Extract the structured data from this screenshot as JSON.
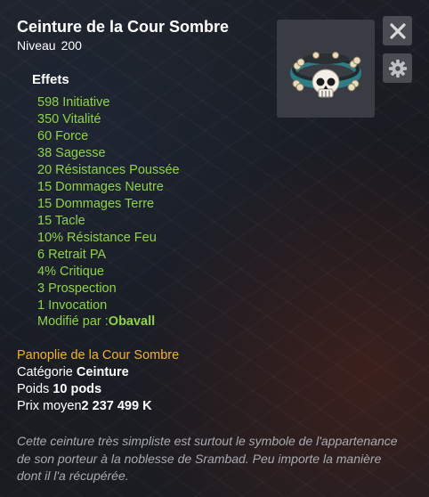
{
  "item": {
    "name": "Ceinture de la Cour Sombre",
    "level_label": "Niveau",
    "level_value": "200",
    "image_alt_icon": "skull-belt-icon"
  },
  "effects": {
    "title": "Effets",
    "lines": [
      "598 Initiative",
      "350 Vitalité",
      "60 Force",
      "38 Sagesse",
      "20 Résistances Poussée",
      "15 Dommages Neutre",
      "15 Dommages Terre",
      "15 Tacle",
      "10% Résistance Feu",
      "6 Retrait PA",
      "4% Critique",
      "3 Prospection",
      "1 Invocation"
    ],
    "modified_label": "Modifié par :",
    "modified_by": "Obavall"
  },
  "details": {
    "set_name": "Panoplie de la Cour Sombre",
    "category_label": "Catégorie",
    "category_value": "Ceinture",
    "weight_label": "Poids",
    "weight_value": "10 pods",
    "price_label": "Prix moyen",
    "price_value": "2 237 499 K"
  },
  "description": "Cette ceinture très simpliste est surtout le symbole de l'appartenance de son porteur à la noblesse de Srambad. Peu importe la manière dont il l'a récupérée.",
  "colors": {
    "effect_green": "#8fd24a",
    "set_gold": "#f0b429",
    "description_gray": "#a9abb0",
    "panel_bg": "#1a1c22"
  }
}
